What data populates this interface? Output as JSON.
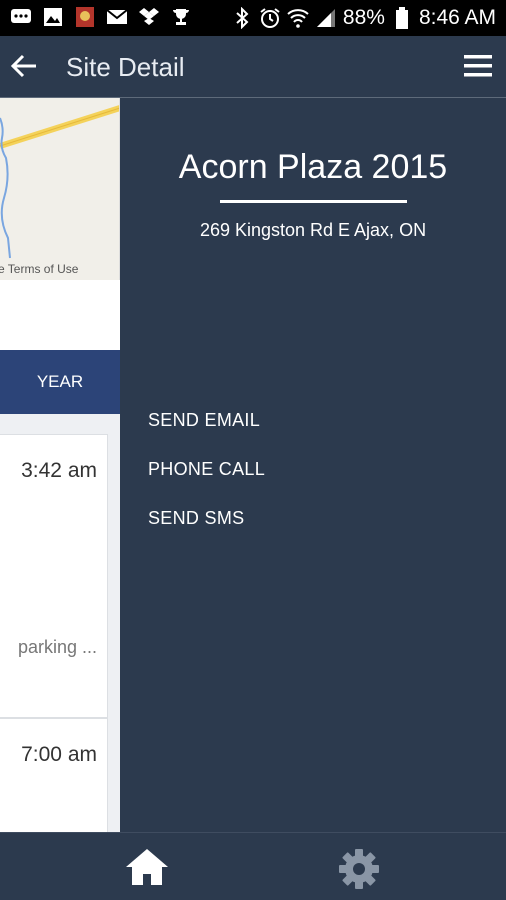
{
  "status_bar": {
    "battery": "88%",
    "time": "8:46 AM",
    "icons": [
      "messenger-icon",
      "image-icon",
      "app-icon",
      "mail-icon",
      "dropbox-icon",
      "trophy-icon",
      "bluetooth-icon",
      "alarm-icon",
      "wifi-icon",
      "signal-icon",
      "battery-icon"
    ]
  },
  "app_bar": {
    "title": "Site Detail"
  },
  "left_page": {
    "map_attribution": "e   Terms of Use",
    "year_tab": "YEAR",
    "cards": [
      {
        "time": "3:42 am",
        "subtitle": "parking ..."
      },
      {
        "time": "7:00 am"
      }
    ]
  },
  "drawer": {
    "site_name": "Acorn Plaza 2015",
    "address": "269 Kingston Rd E Ajax, ON",
    "actions": [
      "SEND EMAIL",
      "PHONE CALL",
      "SEND SMS"
    ]
  },
  "bottom_nav": {
    "items": [
      "home-icon",
      "settings-icon"
    ]
  },
  "colors": {
    "primary": "#2c3a4e",
    "tab_blue": "#2c4478"
  }
}
